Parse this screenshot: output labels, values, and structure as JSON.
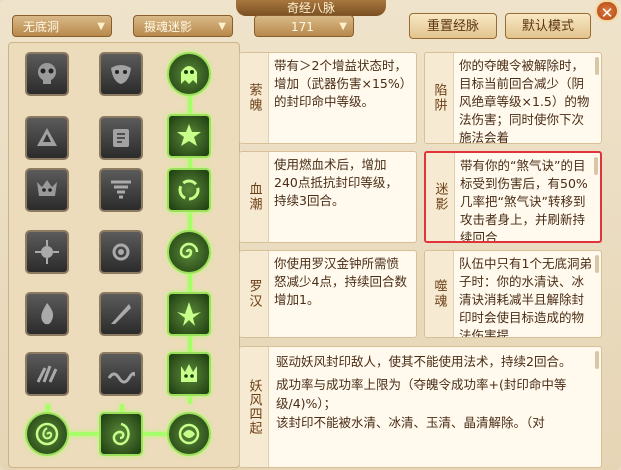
{
  "window": {
    "title": "奇经八脉",
    "close_glyph": "✕"
  },
  "filters": [
    {
      "value": "无底洞"
    },
    {
      "value": "摄魂迷影"
    },
    {
      "value": "171"
    }
  ],
  "buttons": {
    "reset": "重置经脉",
    "default": "默认模式"
  },
  "skills": {
    "rows": [
      [
        "gray",
        "gray",
        "on"
      ],
      [
        "gray",
        "gray",
        "on"
      ],
      [
        "gray",
        "gray",
        "on"
      ],
      [
        "gray",
        "gray",
        "on"
      ],
      [
        "gray",
        "gray",
        "on"
      ],
      [
        "gray",
        "gray",
        "on"
      ],
      [
        "on-round",
        "on",
        "on-round"
      ]
    ]
  },
  "cards": [
    {
      "name": "萦魄",
      "text": "带有＞2个增益状态时，增加（武器伤害×15%）的封印命中等级。"
    },
    {
      "name": "陷阱",
      "text": "你的夺魄令被解除时，目标当前回合减少（阴风绝章等级×1.5）的物法伤害；同时使你下次施法会着"
    },
    {
      "name": "血潮",
      "text": "使用燃血术后，增加240点抵抗封印等级，持续3回合。"
    },
    {
      "name": "迷影",
      "text": "带有你的“煞气诀”的目标受到伤害后，有50%几率把“煞气诀”转移到攻击者身上，并刷新持续回合"
    },
    {
      "name": "罗汉",
      "text": "你使用罗汉金钟所需愤怒减少4点，持续回合数增加1。"
    },
    {
      "name": "噬魂",
      "text": "队伍中只有1个无底洞弟子时：你的水清诀、冰清诀消耗减半且解除封印时会使目标造成的物法伤害提"
    },
    {
      "name": "妖风四起",
      "text": "驱动妖风封印敌人，使其不能使用法术，持续2回合。",
      "text2": "成功率与成功率上限为（夺魄令成功率+(封印命中等级/4)%）；",
      "text3": "该封印不能被水清、冰清、玉清、晶清解除。（对"
    }
  ]
}
